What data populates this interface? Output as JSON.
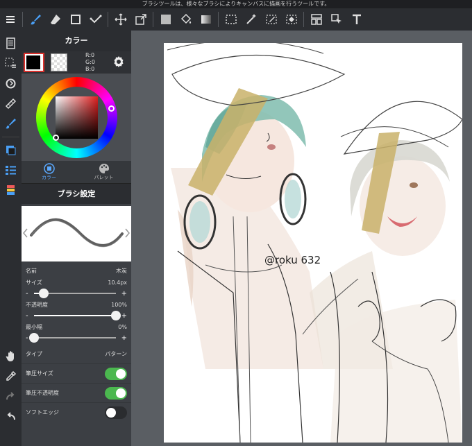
{
  "status_bar": {
    "text": "ブラシツールは、様々なブラシによりキャンバスに描画を行うツールです。"
  },
  "color_panel": {
    "title": "カラー",
    "rgb": {
      "r": "R:0",
      "g": "G:0",
      "b": "B:0"
    },
    "tabs": [
      {
        "label": "カラー"
      },
      {
        "label": "パレット"
      }
    ]
  },
  "brush_settings": {
    "title": "ブラシ設定",
    "name_label": "名前",
    "name_value": "木炭",
    "size_label": "サイズ",
    "size_value": "10.4px",
    "size_level": 0.12,
    "opacity_label": "不透明度",
    "opacity_value": "100%",
    "opacity_level": 1.0,
    "min_width_label": "最小幅",
    "min_width_value": "0%",
    "min_width_level": 0.0,
    "type_label": "タイプ",
    "type_value": "パターン",
    "toggles": [
      {
        "label": "筆圧サイズ",
        "on": true
      },
      {
        "label": "筆圧不透明度",
        "on": true
      },
      {
        "label": "ソフトエッジ",
        "on": false
      }
    ],
    "minus": "-",
    "plus": "+"
  },
  "canvas": {
    "signature": "@roku 632"
  },
  "colors": {
    "accent": "#4a9ff5",
    "toggle_on": "#4bb84f",
    "panel": "#3c3f44",
    "toolbar": "#2b2d31"
  }
}
